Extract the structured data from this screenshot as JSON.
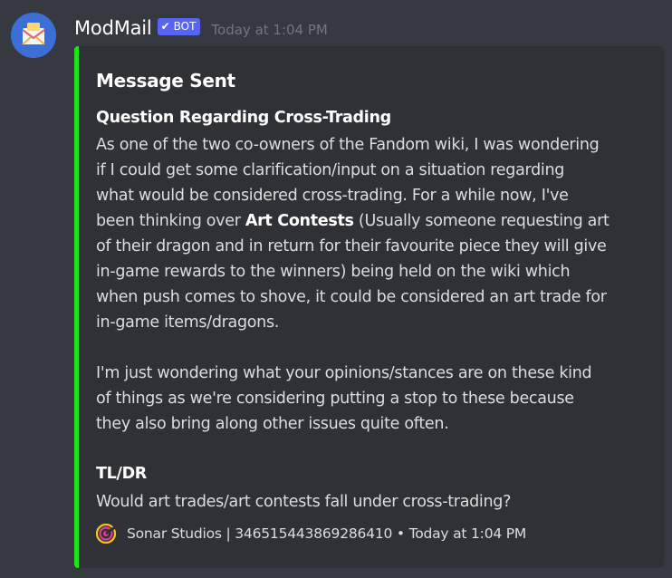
{
  "message": {
    "username": "ModMail",
    "bot_tag": "BOT",
    "timestamp": "Today at 1:04 PM",
    "avatar_icon": "envelope-icon",
    "avatar_color": "#3b6fd6"
  },
  "embed": {
    "accent_color": "#22e11a",
    "title": "Message Sent",
    "fields": [
      {
        "name": "Question Regarding Cross-Trading",
        "paragraphs": [
          [
            "As one of the two co-owners of the Fandom wiki, I was wondering",
            "if I could get some clarification/input on a situation regarding",
            "what would be considered cross-trading. For a while now, I've",
            "been thinking over ",
            "Art Contests",
            " (Usually someone requesting art",
            "of their dragon and in return for their favourite piece they will give",
            "in-game rewards to the winners) being held on the wiki which",
            "when push comes to shove, it could be considered an art trade for",
            "in-game items/dragons."
          ],
          [
            "I'm just wondering what your opinions/stances are on these kind",
            "of things as we're considering putting a stop to these because",
            "they also bring along other issues quite often."
          ]
        ]
      },
      {
        "name": "TL/DR",
        "value": "Would art trades/art contests fall under cross-trading?"
      }
    ],
    "footer": {
      "icon": "sonar-studios-logo-icon",
      "text": "Sonar Studios | 346515443869286410 • Today at 1:04 PM"
    }
  }
}
